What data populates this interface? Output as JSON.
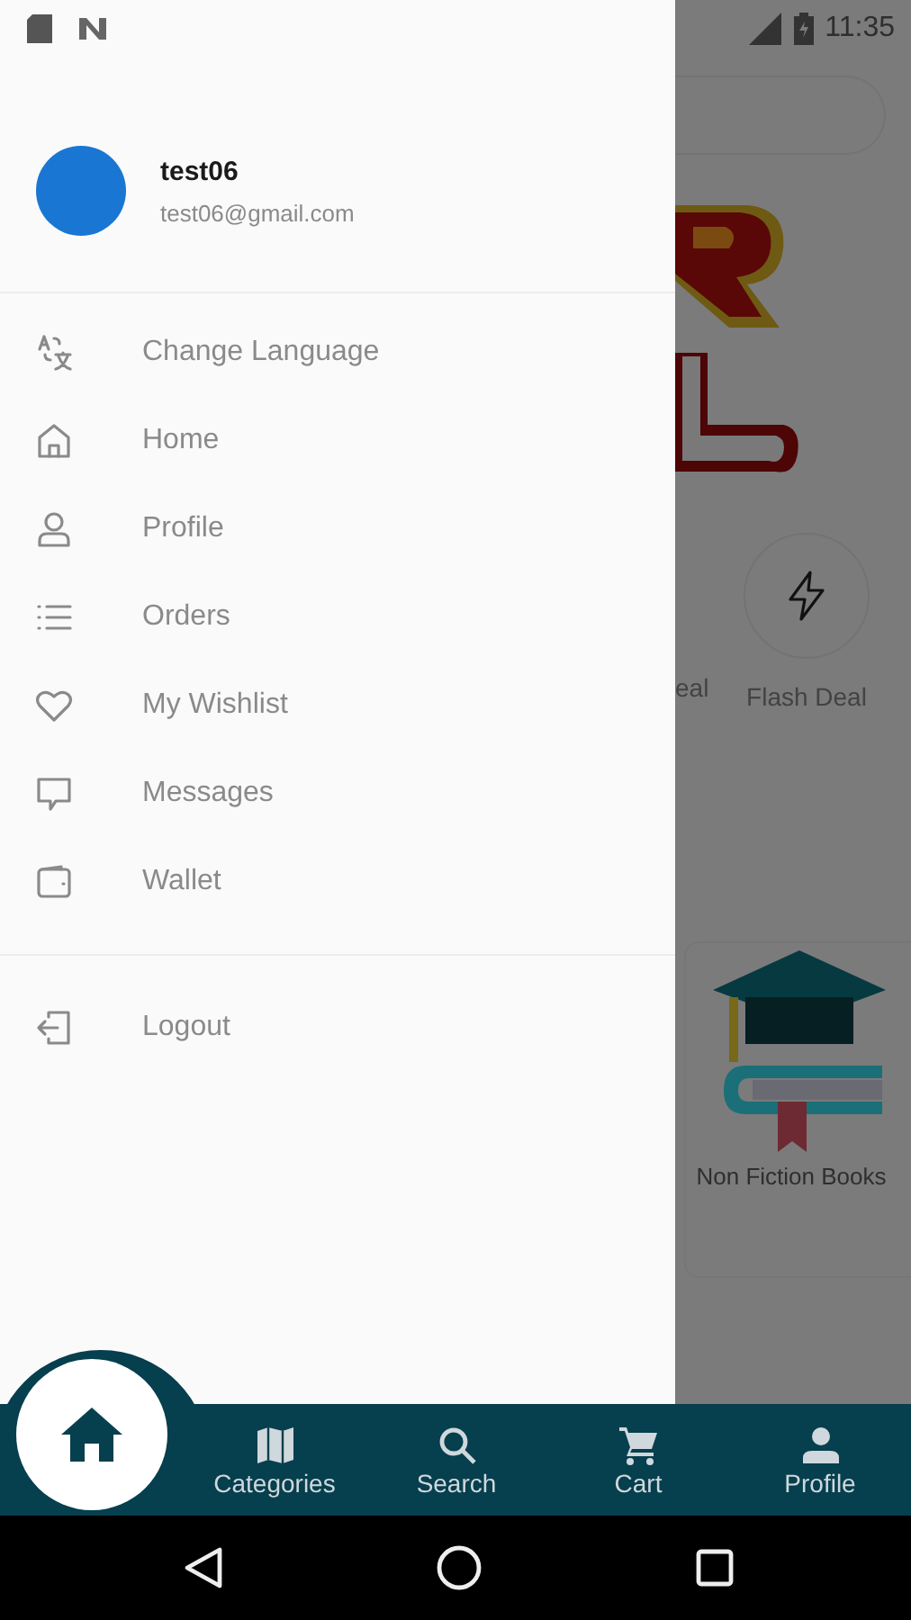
{
  "status_bar": {
    "time": "11:35"
  },
  "drawer": {
    "user": {
      "name": "test06",
      "email": "test06@gmail.com"
    },
    "items": [
      {
        "kind": "translate",
        "label": "Change Language"
      },
      {
        "kind": "home",
        "label": "Home"
      },
      {
        "kind": "person",
        "label": "Profile"
      },
      {
        "kind": "list",
        "label": "Orders"
      },
      {
        "kind": "heart",
        "label": "My Wishlist"
      },
      {
        "kind": "chat",
        "label": "Messages"
      },
      {
        "kind": "wallet",
        "label": "Wallet"
      }
    ],
    "footer_items": [
      {
        "kind": "logout",
        "label": "Logout"
      }
    ]
  },
  "background": {
    "deals": [
      {
        "label": "eal"
      },
      {
        "label": "Flash Deal"
      }
    ],
    "category": {
      "label": "Non Fiction Books"
    }
  },
  "bottom_nav": {
    "items": [
      {
        "kind": "home",
        "selected": true
      },
      {
        "kind": "categories",
        "label": "Categories",
        "selected": false
      },
      {
        "kind": "search",
        "label": "Search",
        "selected": false
      },
      {
        "kind": "cart",
        "label": "Cart",
        "selected": false
      },
      {
        "kind": "profile",
        "label": "Profile",
        "selected": false
      }
    ]
  }
}
